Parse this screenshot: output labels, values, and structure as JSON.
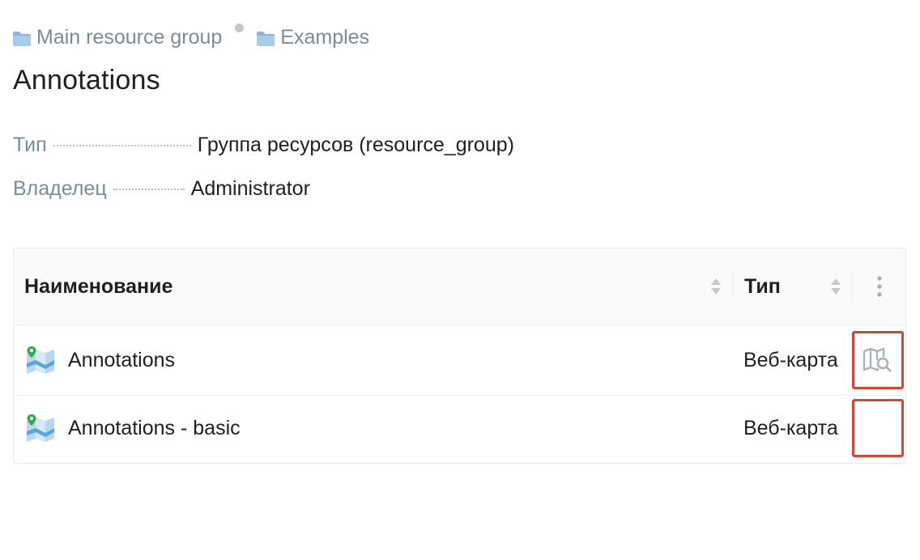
{
  "breadcrumb": {
    "items": [
      {
        "label": "Main resource group",
        "icon": "folder-icon"
      },
      {
        "label": "Examples",
        "icon": "folder-icon"
      }
    ]
  },
  "page": {
    "title": "Annotations"
  },
  "properties": [
    {
      "key": "Тип",
      "value": "Группа ресурсов (resource_group)"
    },
    {
      "key": "Владелец",
      "value": "Administrator"
    }
  ],
  "table": {
    "columns": {
      "name": "Наименование",
      "type": "Тип"
    },
    "rows": [
      {
        "name": "Annotations",
        "type": "Веб-карта",
        "icon": "webmap-icon",
        "action_icon": "map-search-icon"
      },
      {
        "name": "Annotations - basic",
        "type": "Веб-карта",
        "icon": "webmap-icon",
        "action_icon": ""
      }
    ]
  },
  "colors": {
    "folder": "#8ab6e0",
    "highlight": "#d0463a",
    "muted_text": "#7f8a96"
  }
}
